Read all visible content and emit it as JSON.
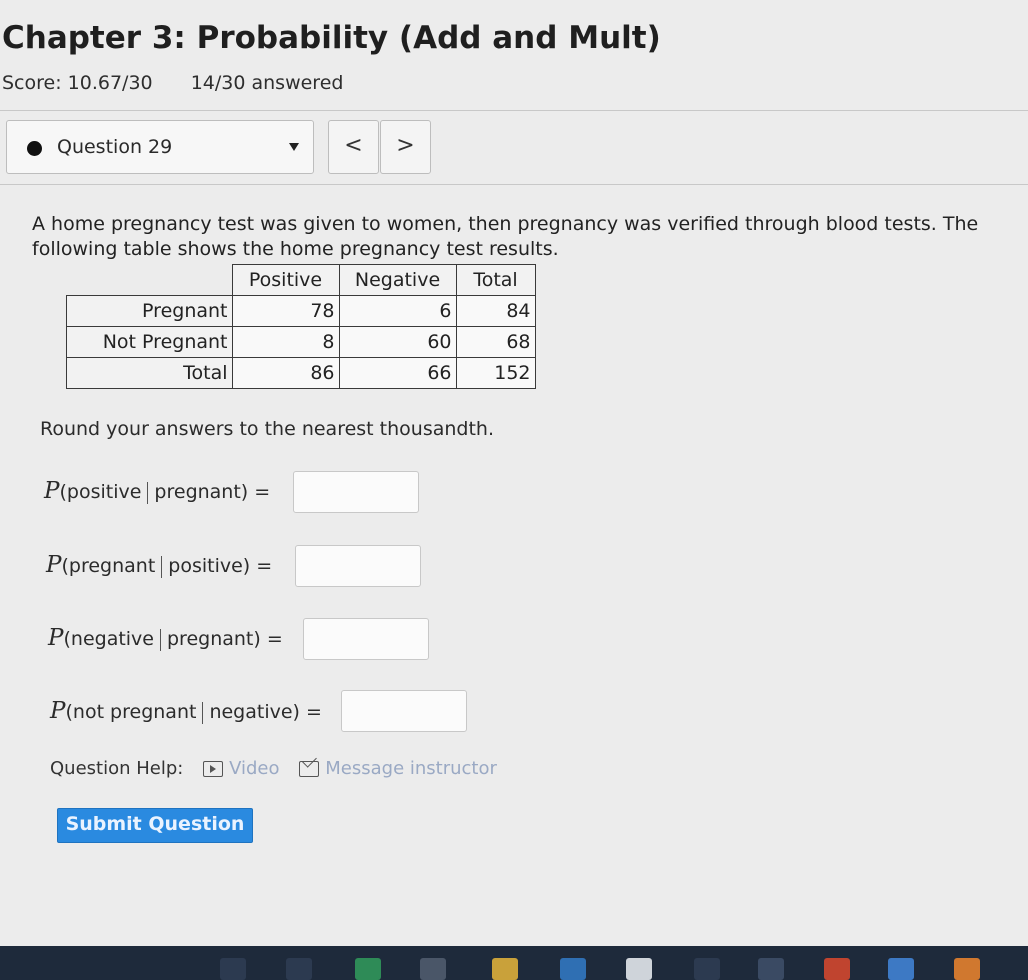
{
  "header": {
    "title": "Chapter 3: Probability (Add and Mult)",
    "score": "Score: 10.67/30",
    "answered": "14/30 answered"
  },
  "question_nav": {
    "label": "Question 29",
    "prev": "<",
    "next": ">"
  },
  "question": {
    "text": "A home pregnancy test was given to women, then pregnancy was verified through blood tests. The following table shows the home pregnancy test results.",
    "table": {
      "columns": [
        "Positive",
        "Negative",
        "Total"
      ],
      "rows": [
        {
          "label": "Pregnant",
          "values": [
            "78",
            "6",
            "84"
          ]
        },
        {
          "label": "Not Pregnant",
          "values": [
            "8",
            "60",
            "68"
          ]
        },
        {
          "label": "Total",
          "values": [
            "86",
            "66",
            "152"
          ]
        }
      ]
    },
    "instruction": "Round your answers to the nearest thousandth.",
    "probabilities": [
      {
        "P": "P",
        "a": "(positive",
        "b": "pregnant) =",
        "value": ""
      },
      {
        "P": "P",
        "a": "(pregnant",
        "b": "positive) =",
        "value": ""
      },
      {
        "P": "P",
        "a": "(negative",
        "b": "pregnant) =",
        "value": ""
      },
      {
        "P": "P",
        "a": "(not pregnant",
        "b": "negative) =",
        "value": ""
      }
    ]
  },
  "help": {
    "label": "Question Help:",
    "video": "Video",
    "message": "Message instructor"
  },
  "submit_label": "Submit Question",
  "taskbar": {
    "icons": [
      "cortana-icon",
      "task-view-icon",
      "chrome-icon",
      "store-icon",
      "file-explorer-icon",
      "mail-icon",
      "amazon-icon",
      "back-icon",
      "dropbox-icon",
      "office-icon",
      "chrome-app-icon",
      "chrome-dev-icon"
    ]
  }
}
